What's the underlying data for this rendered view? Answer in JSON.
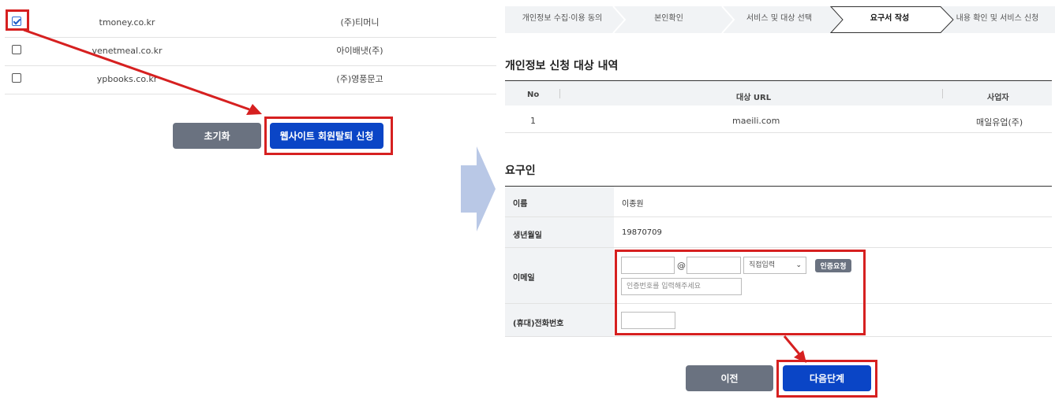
{
  "left": {
    "rows": [
      {
        "url": "tmoney.co.kr",
        "company": "(주)티머니",
        "checked": true
      },
      {
        "url": "venetmeal.co.kr",
        "company": "아이배냇(주)",
        "checked": false
      },
      {
        "url": "ypbooks.co.kr",
        "company": "(주)영풍문고",
        "checked": false
      }
    ],
    "reset_label": "초기화",
    "apply_label": "웹사이트 회원탈퇴 신청"
  },
  "steps": [
    "개인정보 수집·이용 동의",
    "본인확인",
    "서비스 및 대상 선택",
    "요구서 작성",
    "내용 확인 및 서비스 신청"
  ],
  "active_step": 3,
  "target": {
    "title": "개인정보 신청 대상 내역",
    "headers": {
      "no": "No",
      "url": "대상 URL",
      "company": "사업자"
    },
    "rows": [
      {
        "no": "1",
        "url": "maeili.com",
        "company": "매일유업(주)"
      }
    ]
  },
  "requester": {
    "title": "요구인",
    "name_label": "이름",
    "name_value": "이종원",
    "birth_label": "생년월일",
    "birth_value": "19870709",
    "email_label": "이메일",
    "email_at": "@",
    "email_select": "직접입력",
    "verify_button": "인증요청",
    "code_placeholder": "인증번호를 입력해주세요",
    "phone_label": "(휴대)전화번호"
  },
  "nav": {
    "prev_label": "이전",
    "next_label": "다음단계"
  },
  "colors": {
    "accent_blue": "#0a45c6",
    "gray_button": "#6a7280",
    "highlight_red": "#d62020"
  }
}
